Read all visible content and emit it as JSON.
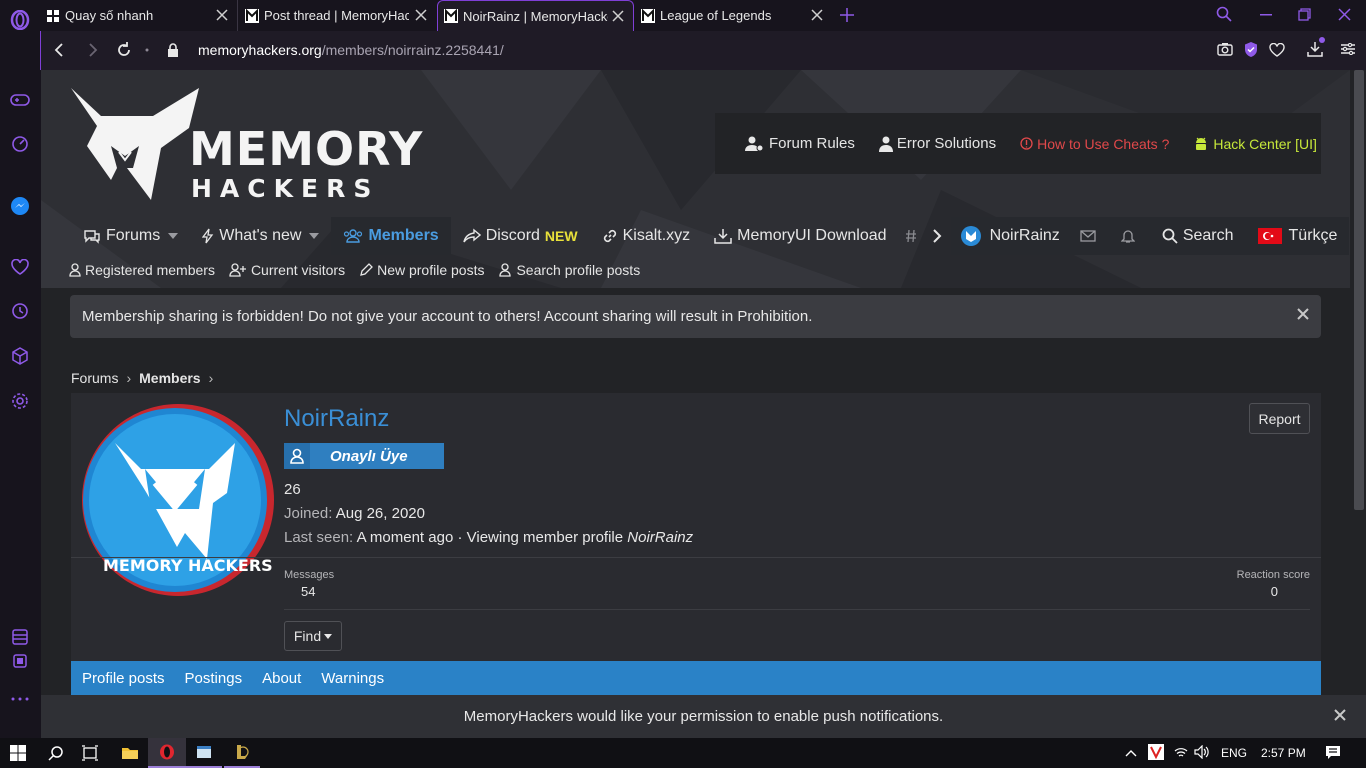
{
  "browser": {
    "tabs": [
      {
        "label": "Quay số nhanh"
      },
      {
        "label": "Post thread | MemoryHackers"
      },
      {
        "label": "NoirRainz | MemoryHackers"
      },
      {
        "label": "League of Legends"
      }
    ],
    "url_domain": "memoryhackers.org",
    "url_path": "/members/noirrainz.2258441/"
  },
  "site": {
    "logo_text_1": "MEMORY",
    "logo_text_2": "HACKERS",
    "top_links": {
      "forum_rules": "Forum Rules",
      "error_solutions": "Error Solutions",
      "how_to_use": "How to Use Cheats ?",
      "hack_center": "Hack Center [UI]"
    },
    "nav": {
      "forums": "Forums",
      "whats_new": "What's new",
      "members": "Members",
      "discord": "Discord",
      "discord_badge": "NEW",
      "kisalt": "Kisalt.xyz",
      "memoryui": "MemoryUI Download",
      "user": "NoirRainz",
      "search": "Search",
      "language": "Türkçe"
    },
    "subnav": {
      "registered": "Registered members",
      "current": "Current visitors",
      "new_posts": "New profile posts",
      "search_posts": "Search profile posts"
    },
    "notice": "Membership sharing is forbidden! Do not give your account to others! Account sharing will result in Prohibition.",
    "breadcrumb": [
      "Forums",
      "Members"
    ]
  },
  "profile": {
    "name": "NoirRainz",
    "rank": "Onaylı Üye",
    "title": "26",
    "joined_label": "Joined:",
    "joined_value": "Aug 26, 2020",
    "seen_label": "Last seen:",
    "seen_value": "A moment ago",
    "seen_activity": "· Viewing member profile",
    "seen_activity_target": "NoirRainz",
    "report": "Report",
    "messages_label": "Messages",
    "messages_value": "54",
    "reaction_label": "Reaction score",
    "reaction_value": "0",
    "find": "Find",
    "avatar_text": "MEMORY HACKERS",
    "tabs": [
      "Profile posts",
      "Postings",
      "About",
      "Warnings"
    ]
  },
  "push_notice": "MemoryHackers would like your permission to enable push notifications.",
  "taskbar": {
    "lang": "ENG",
    "time": "2:57 PM"
  },
  "colors": {
    "accent_purple": "#7f3fd6",
    "profile_blue": "#2a82c7",
    "name_blue": "#3a8fd6",
    "hack_center_green": "#c7e83a",
    "how_to_red": "#e0484a",
    "discord_new_yellow": "#e8e03a"
  }
}
